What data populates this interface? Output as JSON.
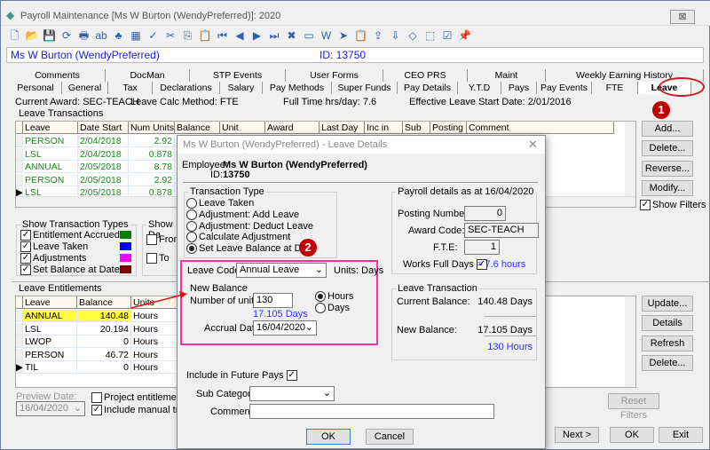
{
  "window": {
    "title": "Payroll Maintenance  [Ms W Burton (WendyPreferred)]:  2020",
    "close": "⊠"
  },
  "toolbar": [
    "new",
    "open",
    "save",
    "refresh",
    "print",
    "text",
    "tree",
    "calculator",
    "spellcheck",
    "cut",
    "copy",
    "paste",
    "first",
    "previous",
    "next",
    "last",
    "delete",
    "card",
    "word",
    "send",
    "clipboard",
    "export",
    "import",
    "tag",
    "select",
    "checklist",
    "pin"
  ],
  "namebar": {
    "name": "Ms W Burton (WendyPreferred)",
    "id": "ID: 13750"
  },
  "tabs_row1": [
    "Comments",
    "DocMan",
    "STP Events",
    "User Forms",
    "CEO PRS",
    "Maint",
    "Weekly Earning History"
  ],
  "tabs_row2": [
    "Personal",
    "General",
    "Tax",
    "Declarations",
    "Salary",
    "Pay Methods",
    "Super Funds",
    "Pay Details",
    "Y.T.D",
    "Pays",
    "Pay Events",
    "FTE",
    "Leave"
  ],
  "info": {
    "award": "Current Award: SEC-TEACH",
    "calc": "Leave Calc Method: FTE",
    "hours": "Full Time hrs/day: 7.6",
    "start": "Effective Leave Start Date: 2/01/2016"
  },
  "transactions": {
    "title": "Leave Transactions",
    "columns": [
      "Leave",
      "Date Start",
      "Num Units",
      "Balance",
      "Unit",
      "Award",
      "Last Day",
      "Inc in Pay",
      "Sub Cat",
      "Posting",
      "Comment"
    ],
    "rows": [
      [
        "PERSON",
        "2/04/2018",
        "2.92"
      ],
      [
        "LSL",
        "2/04/2018",
        "0.878"
      ],
      [
        "ANNUAL",
        "2/05/2018",
        "8.78"
      ],
      [
        "PERSON",
        "2/05/2018",
        "2.92"
      ],
      [
        "LSL",
        "2/05/2018",
        "0.878"
      ]
    ],
    "row_color": "#1a8a1a"
  },
  "trans_buttons": [
    "Add...",
    "Delete...",
    "Reverse...",
    "Modify..."
  ],
  "show_filters": "Show Filters",
  "types": {
    "title": "Show Transaction Types",
    "items": [
      {
        "label": "Entitlement Accrued",
        "color": "#008000"
      },
      {
        "label": "Leave Taken",
        "color": "#0000ff"
      },
      {
        "label": "Adjustments",
        "color": "#ff00ff"
      },
      {
        "label": "Set Balance at Date",
        "color": "#800000"
      }
    ]
  },
  "show_dates": {
    "title": "Show Da",
    "from": "From",
    "to": "To"
  },
  "entitlements": {
    "title": "Leave Entitlements",
    "columns": [
      "Leave",
      "Balance",
      "Units"
    ],
    "rows": [
      [
        "ANNUAL",
        "140.48",
        "Hours"
      ],
      [
        "LSL",
        "20.194",
        "Hours"
      ],
      [
        "LWOP",
        "0",
        "Hours"
      ],
      [
        "PERSON",
        "46.72",
        "Hours"
      ],
      [
        "TIL",
        "0",
        "Hours"
      ]
    ],
    "highlight": "#ffff40"
  },
  "ent_buttons": [
    "Update...",
    "Details",
    "Refresh",
    "Delete..."
  ],
  "reset_filters": "Reset Filters",
  "preview": {
    "label": "Preview Date:",
    "value": "16/04/2020",
    "project": "Project entitlements to",
    "include": "Include manual transa"
  },
  "bottom_buttons": [
    "Next >",
    "OK",
    "Exit"
  ],
  "badges": [
    "1",
    "2"
  ],
  "dialog": {
    "title": "Ms W Burton (WendyPreferred) - Leave Details",
    "close": "✕",
    "employee_label": "Employee:",
    "employee": "Ms W Burton (WendyPreferred)",
    "id_label": "ID:",
    "id": "13750",
    "ttype": {
      "title": "Transaction Type",
      "options": [
        "Leave Taken",
        "Adjustment: Add Leave",
        "Adjustment: Deduct Leave",
        "Calculate Adjustment",
        "Set Leave Balance at Date"
      ],
      "selected": 4
    },
    "payroll": {
      "title": "Payroll details as at 16/04/2020",
      "posting_label": "Posting Number:",
      "posting": "0",
      "award_label": "Award Code:",
      "award": "SEC-TEACH",
      "fte_label": "F.T.E:",
      "fte": "1",
      "full_days_label": "Works Full Days",
      "full_days_hours": "= 7.6 hours"
    },
    "leave_code_label": "Leave Code:",
    "leave_code": "Annual Leave",
    "units": "Units: Days",
    "new_balance": {
      "title": "New Balance",
      "units_label": "Number of units:",
      "units_value": "130",
      "days_calc": "17.105 Days",
      "hours": "Hours",
      "days": "Days",
      "accrual_label": "Accrual Date:",
      "accrual": "16/04/2020"
    },
    "leave_txn": {
      "title": "Leave Transaction",
      "current_label": "Current Balance:",
      "current": "140.48 Days",
      "new_label": "New Balance:",
      "new": "17.105 Days",
      "new_hours": "130 Hours"
    },
    "future_pays": "Include in Future Pays",
    "sub_cat_label": "Sub Category:",
    "comment_label": "Comment:",
    "ok": "OK",
    "cancel": "Cancel"
  }
}
